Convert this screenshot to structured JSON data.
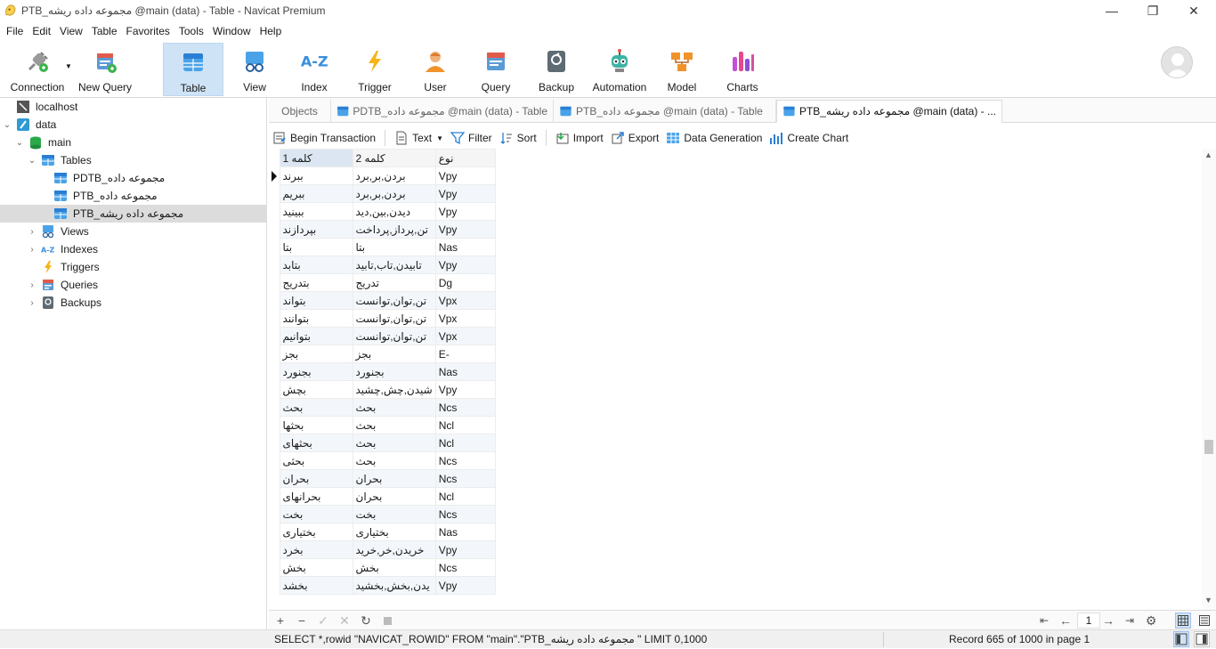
{
  "window": {
    "title": "PTB_مجموعه داده ریشه @main (data) - Table - Navicat Premium"
  },
  "menu": [
    "File",
    "Edit",
    "View",
    "Table",
    "Favorites",
    "Tools",
    "Window",
    "Help"
  ],
  "toolbar": {
    "connection": "Connection",
    "new_query": "New Query",
    "table": "Table",
    "view": "View",
    "index": "Index",
    "trigger": "Trigger",
    "user": "User",
    "query": "Query",
    "backup": "Backup",
    "automation": "Automation",
    "model": "Model",
    "charts": "Charts"
  },
  "sidebar": {
    "items": [
      {
        "label": "localhost"
      },
      {
        "label": "data"
      },
      {
        "label": "main"
      },
      {
        "label": "Tables"
      },
      {
        "label": "PDTB_مجموعه داده"
      },
      {
        "label": "PTB_مجموعه داده"
      },
      {
        "label": "PTB_مجموعه داده ریشه"
      },
      {
        "label": "Views"
      },
      {
        "label": "Indexes"
      },
      {
        "label": "Triggers"
      },
      {
        "label": "Queries"
      },
      {
        "label": "Backups"
      }
    ]
  },
  "tabs": {
    "objects": "Objects",
    "tab1": "PDTB_مجموعه داده @main (data) - Table",
    "tab2": "PTB_مجموعه داده @main (data) - Table",
    "tab3": "PTB_مجموعه داده ریشه @main (data) - ..."
  },
  "actions": {
    "begin_transaction": "Begin Transaction",
    "text": "Text",
    "filter": "Filter",
    "sort": "Sort",
    "import": "Import",
    "export": "Export",
    "data_generation": "Data Generation",
    "create_chart": "Create Chart"
  },
  "grid": {
    "columns": [
      "کلمه 1",
      "کلمه 2",
      "نوع"
    ],
    "rows": [
      [
        "ببرند",
        "بردن,بر,برد",
        "Vpy"
      ],
      [
        "ببریم",
        "بردن,بر,برد",
        "Vpy"
      ],
      [
        "ببینید",
        "دیدن,بین,دید",
        "Vpy"
      ],
      [
        "بپردازند",
        "تن,پرداز,پرداخت",
        "Vpy"
      ],
      [
        "بتا",
        "بتا",
        "Nas"
      ],
      [
        "بتابد",
        "تابیدن,تاب,تابید",
        "Vpy"
      ],
      [
        "بتدریج",
        "تدریج",
        "Dg"
      ],
      [
        "بتواند",
        "تن,توان,توانست",
        "Vpx"
      ],
      [
        "بتوانند",
        "تن,توان,توانست",
        "Vpx"
      ],
      [
        "بتوانیم",
        "تن,توان,توانست",
        "Vpx"
      ],
      [
        "بجز",
        "بجز",
        "E-"
      ],
      [
        "بجنورد",
        "بجنورد",
        "Nas"
      ],
      [
        "بچش",
        "شیدن,چش,چشید",
        "Vpy"
      ],
      [
        "بحث",
        "بحث",
        "Ncs"
      ],
      [
        "بحثها",
        "بحث",
        "Ncl"
      ],
      [
        "بحثهای",
        "بحث",
        "Ncl"
      ],
      [
        "بحثی",
        "بحث",
        "Ncs"
      ],
      [
        "بحران",
        "بحران",
        "Ncs"
      ],
      [
        "بحرانهای",
        "بحران",
        "Ncl"
      ],
      [
        "بخت",
        "بخت",
        "Ncs"
      ],
      [
        "بختیاری",
        "بختیاری",
        "Nas"
      ],
      [
        "بخرد",
        "خریدن,خر,خرید",
        "Vpy"
      ],
      [
        "بخش",
        "بخش",
        "Ncs"
      ],
      [
        "بخشد",
        "یدن,بخش,بخشید",
        "Vpy"
      ]
    ]
  },
  "pager": {
    "page": "1"
  },
  "status": {
    "sql": "SELECT *,rowid \"NAVICAT_ROWID\" FROM \"main\".\"PTB_مجموعه داده ریشه \" LIMIT 0,1000",
    "record": "Record 665 of 1000 in page 1"
  },
  "colors": {
    "accent": "#2a7fd4",
    "selected_row": "#dcdcdc",
    "active_tab_bg": "#cfe3f7"
  }
}
